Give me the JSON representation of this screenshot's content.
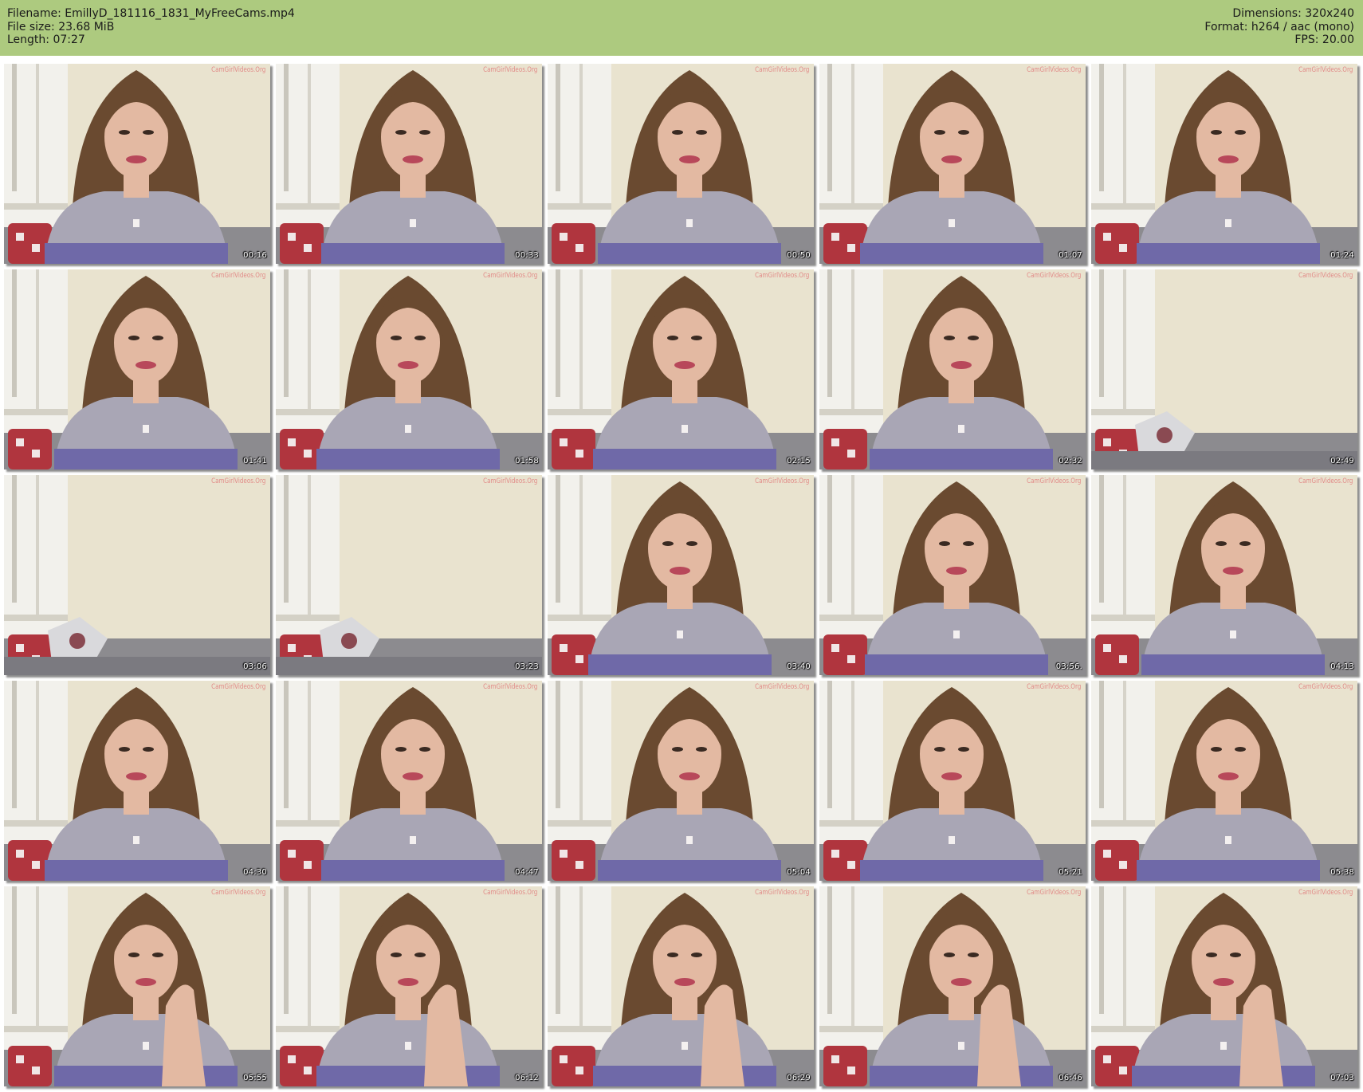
{
  "header": {
    "filename": "Filename: EmillyD_181116_1831_MyFreeCams.mp4",
    "filesize": "File size: 23.68 MiB",
    "length": "Length: 07:27",
    "dimensions": "Dimensions: 320x240",
    "format": "Format: h264 / aac (mono)",
    "fps": "FPS: 20.00"
  },
  "watermark_text": "CamGirlVideos.Org",
  "thumbnails": [
    {
      "time": "00:16",
      "scene": "person"
    },
    {
      "time": "00:33",
      "scene": "person"
    },
    {
      "time": "00:50",
      "scene": "person"
    },
    {
      "time": "01:07",
      "scene": "person"
    },
    {
      "time": "01:24",
      "scene": "person"
    },
    {
      "time": "01:41",
      "scene": "person"
    },
    {
      "time": "01:58",
      "scene": "person"
    },
    {
      "time": "02:15",
      "scene": "person"
    },
    {
      "time": "02:32",
      "scene": "person"
    },
    {
      "time": "02:49",
      "scene": "empty"
    },
    {
      "time": "03:06",
      "scene": "empty"
    },
    {
      "time": "03:23",
      "scene": "empty"
    },
    {
      "time": "03:40",
      "scene": "person"
    },
    {
      "time": "03:56.",
      "scene": "person"
    },
    {
      "time": "04:13",
      "scene": "person"
    },
    {
      "time": "04:30",
      "scene": "person"
    },
    {
      "time": "04:47",
      "scene": "person"
    },
    {
      "time": "05:04",
      "scene": "person"
    },
    {
      "time": "05:21",
      "scene": "person"
    },
    {
      "time": "05:38",
      "scene": "person"
    },
    {
      "time": "05:55",
      "scene": "person-hand"
    },
    {
      "time": "06:12",
      "scene": "person-hand"
    },
    {
      "time": "06:29",
      "scene": "person-hand"
    },
    {
      "time": "06:46",
      "scene": "person-hand"
    },
    {
      "time": "07:03",
      "scene": "person-hand"
    }
  ],
  "colors": {
    "header_bg": "#adca7f",
    "wall": "#e9e3cf",
    "hair": "#6a4a30",
    "shirt": "#a9a6b5",
    "shirt_stripe": "#6f69a8",
    "skin": "#e3b9a2"
  }
}
